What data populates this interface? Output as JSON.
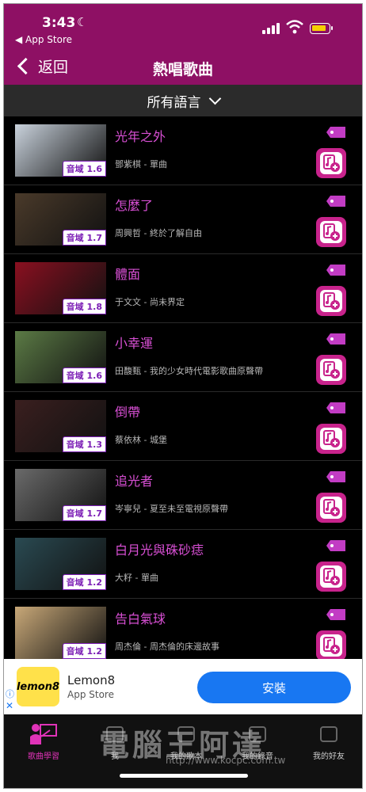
{
  "status": {
    "time": "3:43",
    "back_app": "◀ App Store"
  },
  "header": {
    "back_label": "返回",
    "title": "熱唱歌曲"
  },
  "filter": {
    "label": "所有語言"
  },
  "songs": [
    {
      "title": "光年之外",
      "artist": "鄧紫棋 - 單曲",
      "range": "音域 1.6",
      "thumb": "#c9d2dc"
    },
    {
      "title": "怎麼了",
      "artist": "周興哲 - 終於了解自由",
      "range": "音域 1.7",
      "thumb": "#4a3a2a"
    },
    {
      "title": "體面",
      "artist": "于文文 - 尚未界定",
      "range": "音域 1.8",
      "thumb": "#8a1020"
    },
    {
      "title": "小幸運",
      "artist": "田馥甄 - 我的少女時代電影歌曲原聲帶",
      "range": "音域 1.6",
      "thumb": "#5b7a45"
    },
    {
      "title": "倒帶",
      "artist": "蔡依林 - 城堡",
      "range": "音域 1.3",
      "thumb": "#3a1f1f"
    },
    {
      "title": "追光者",
      "artist": "岑寧兒 - 夏至未至電視原聲帶",
      "range": "音域 1.7",
      "thumb": "#6a6a6a"
    },
    {
      "title": "白月光與硃砂痣",
      "artist": "大籽 - 單曲",
      "range": "音域 1.2",
      "thumb": "#2a4a52"
    },
    {
      "title": "告白氣球",
      "artist": "周杰倫 - 周杰倫的床邊故事",
      "range": "音域 1.2",
      "thumb": "#c8a878"
    }
  ],
  "ad": {
    "name": "Lemon8",
    "sub": "App Store",
    "logo": "lemon8",
    "button": "安裝",
    "info": "ⓘ",
    "close": "✕"
  },
  "tabs": [
    {
      "label": "歌曲學習",
      "icon": "learn-icon"
    },
    {
      "label": "我",
      "icon": "me-icon"
    },
    {
      "label": "我的歌本",
      "icon": "songbook-icon"
    },
    {
      "label": "我的錄音",
      "icon": "recording-icon"
    },
    {
      "label": "我的好友",
      "icon": "friends-icon"
    }
  ],
  "watermark": {
    "text": "電腦王阿達",
    "url": "http://www.kocpc.com.tw"
  },
  "colors": {
    "header": "#8e1064",
    "accent": "#d84fd4",
    "button": "#c8238c",
    "ad_button": "#1877f2"
  }
}
